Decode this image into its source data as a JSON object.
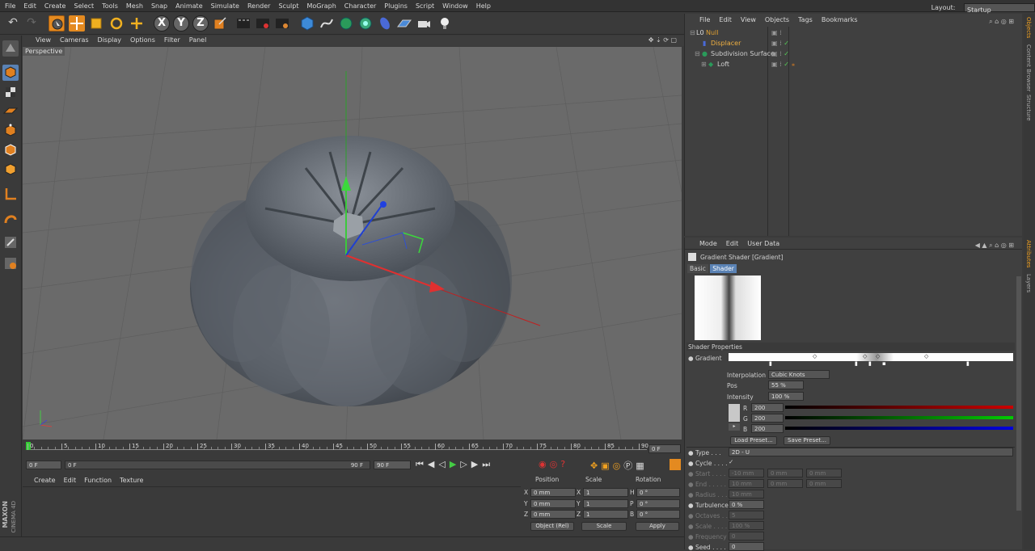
{
  "menubar": [
    "File",
    "Edit",
    "Create",
    "Select",
    "Tools",
    "Mesh",
    "Snap",
    "Animate",
    "Simulate",
    "Render",
    "Sculpt",
    "MoGraph",
    "Character",
    "Plugins",
    "Script",
    "Window",
    "Help"
  ],
  "layout": {
    "label": "Layout:",
    "value": "Startup"
  },
  "axes": {
    "x": "X",
    "y": "Y",
    "z": "Z"
  },
  "viewport": {
    "menu": [
      "View",
      "Cameras",
      "Display",
      "Options",
      "Filter",
      "Panel"
    ],
    "label": "Perspective"
  },
  "timeline": {
    "ticks": [
      "0",
      "5",
      "10",
      "15",
      "20",
      "25",
      "30",
      "35",
      "40",
      "45",
      "50",
      "55",
      "60",
      "65",
      "70",
      "75",
      "80",
      "85",
      "90"
    ],
    "frame": "0 F",
    "start": "0 F",
    "range_start": "0 F",
    "range_end": "90 F",
    "end": "90 F"
  },
  "material": {
    "menu": [
      "Create",
      "Edit",
      "Function",
      "Texture"
    ]
  },
  "coords": {
    "headers": [
      "Position",
      "Scale",
      "Rotation"
    ],
    "rows": [
      {
        "a": "X",
        "p": "0 mm",
        "b": "X",
        "s": "1",
        "c": "H",
        "r": "0 °"
      },
      {
        "a": "Y",
        "p": "0 mm",
        "b": "Y",
        "s": "1",
        "c": "P",
        "r": "0 °"
      },
      {
        "a": "Z",
        "p": "0 mm",
        "b": "Z",
        "s": "1",
        "c": "B",
        "r": "0 °"
      }
    ],
    "mode": "Object (Rel)",
    "scale_mode": "Scale",
    "apply": "Apply"
  },
  "objects": {
    "menu": [
      "File",
      "Edit",
      "View",
      "Objects",
      "Tags",
      "Bookmarks"
    ],
    "items": [
      {
        "name": "Null",
        "color": "#e0a030"
      },
      {
        "name": "Displacer",
        "color": "#f0b040"
      },
      {
        "name": "Subdivision Surface",
        "color": "#d8d8d8"
      },
      {
        "name": "Loft",
        "color": "#d8d8d8"
      }
    ]
  },
  "attributes": {
    "menu": [
      "Mode",
      "Edit",
      "User Data"
    ],
    "title": "Gradient Shader [Gradient]",
    "tabs": [
      "Basic",
      "Shader"
    ],
    "section": "Shader Properties",
    "gradient_label": "Gradient",
    "interpolation": {
      "label": "Interpolation",
      "value": "Cubic Knots"
    },
    "pos": {
      "label": "Pos",
      "value": "55 %"
    },
    "intensity": {
      "label": "Intensity",
      "value": "100 %"
    },
    "r": {
      "label": "R",
      "value": "200"
    },
    "g": {
      "label": "G",
      "value": "200"
    },
    "b": {
      "label": "B",
      "value": "200"
    },
    "load_preset": "Load Preset...",
    "save_preset": "Save Preset...",
    "type": {
      "label": "Type",
      "value": "2D - U"
    },
    "cycle": {
      "label": "Cycle",
      "value": "✓"
    },
    "start": {
      "label": "Start",
      "v1": "-10 mm",
      "v2": "0 mm",
      "v3": "0 mm"
    },
    "end": {
      "label": "End",
      "v1": "10 mm",
      "v2": "0 mm",
      "v3": "0 mm"
    },
    "radius": {
      "label": "Radius",
      "value": "10 mm"
    },
    "turbulence": {
      "label": "Turbulence",
      "value": "0 %"
    },
    "octaves": {
      "label": "Octaves",
      "value": "5"
    },
    "scale": {
      "label": "Scale",
      "value": "100 %"
    },
    "frequency": {
      "label": "Frequency",
      "value": "0"
    },
    "seed": {
      "label": "Seed",
      "value": "0"
    }
  },
  "right_tabs": [
    "Objects",
    "Content Browser",
    "Structure",
    "Attributes",
    "Layers"
  ],
  "brand": {
    "line1": "MAXON",
    "line2": "CINEMA 4D"
  },
  "colors": {
    "accent": "#f0a020",
    "selected": "#5a82b4"
  }
}
